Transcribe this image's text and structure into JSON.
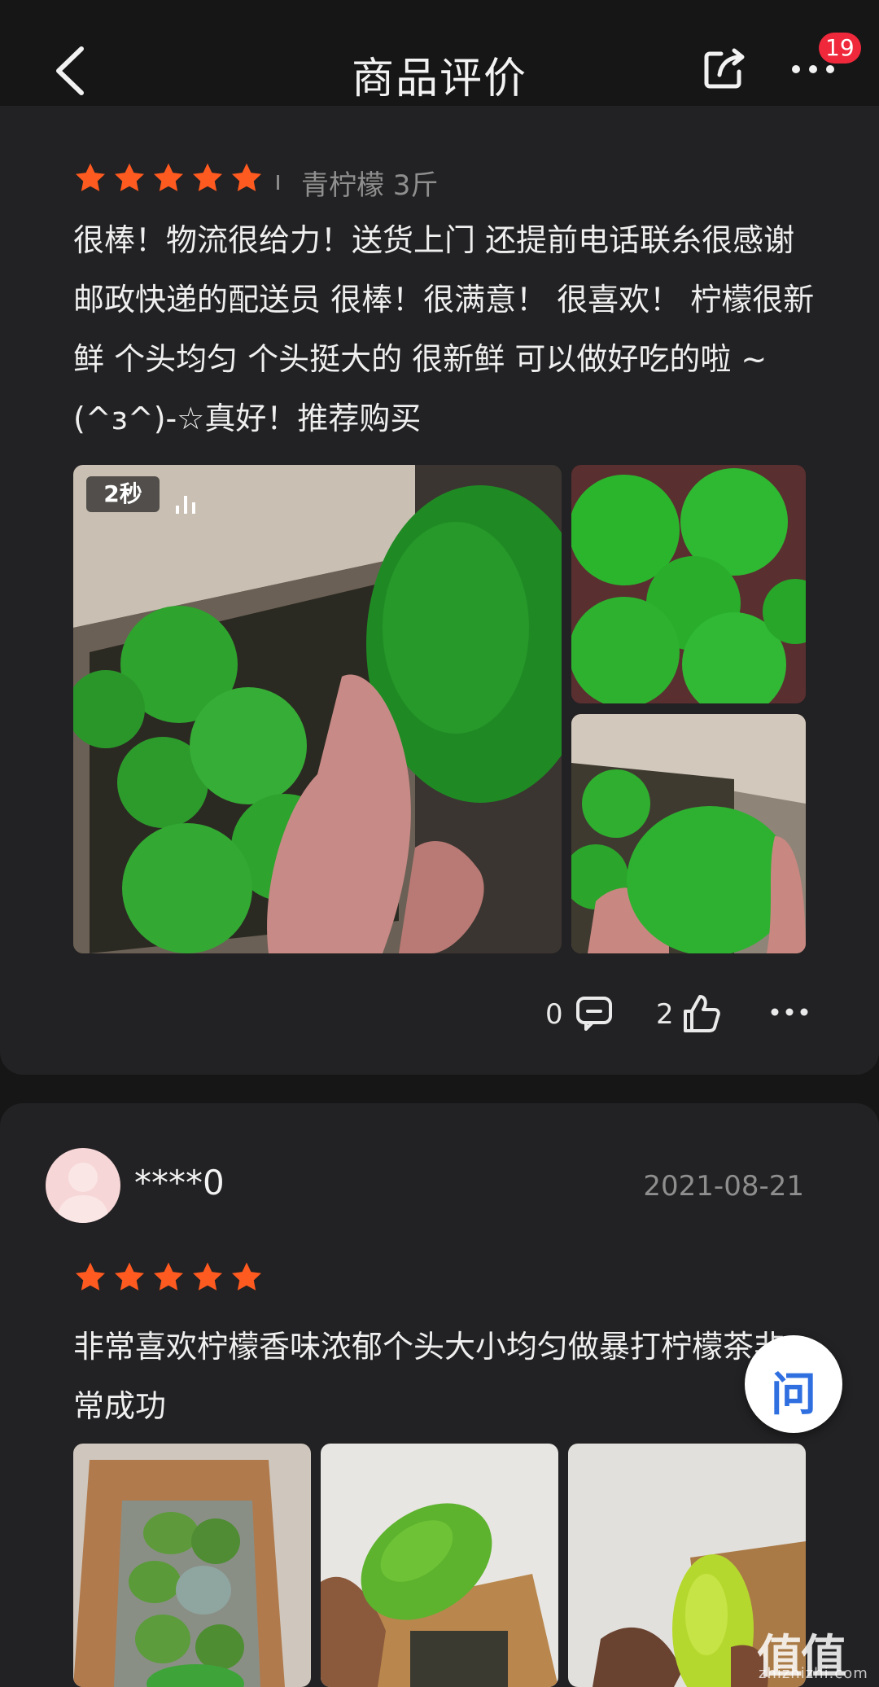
{
  "header": {
    "title": "商品评价",
    "notification_count": "19"
  },
  "review1": {
    "rating": 5,
    "spec": "青柠檬 3斤",
    "text": "很棒！物流很给力！送货上门 还提前电话联糸很感谢邮政快递的配送员 很棒！很满意！ 很喜欢！ 柠檬很新鲜 个头均匀 个头挺大的 很新鲜 可以做好吃的啦 ~ (^з^)-☆真好！推荐购买",
    "video_duration": "2秒",
    "comment_count": "0",
    "like_count": "2"
  },
  "review2": {
    "username": "****0",
    "date": "2021-08-21",
    "rating": 5,
    "text": "非常喜欢柠檬香味浓郁个头大小均匀做暴打柠檬茶非常成功"
  },
  "floating": {
    "ask_label": "问"
  },
  "watermark": {
    "main": "值值值",
    "sub": "zhizhizhi.com"
  },
  "colors": {
    "star": "#ff5a1f",
    "background": "#161616",
    "card": "#222123",
    "badge": "#f0283c",
    "ask": "#2f6fe0"
  }
}
